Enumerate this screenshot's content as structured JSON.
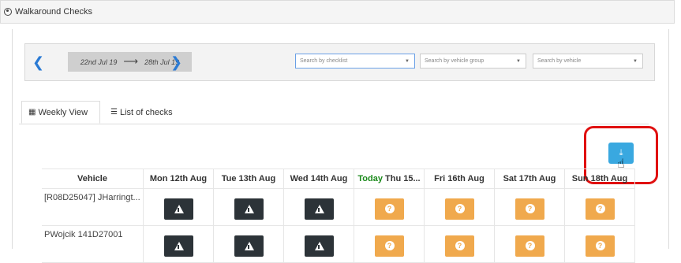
{
  "header": {
    "title": "Walkaround Checks",
    "icon": "user-circle-icon"
  },
  "date_nav": {
    "start": "22nd Jul 19",
    "end": "28th Jul 19",
    "arrow": "⟶"
  },
  "filters": {
    "checklist_placeholder": "Search by checklist",
    "vehicle_group_placeholder": "Search by vehicle group",
    "vehicle_placeholder": "Search by vehicle"
  },
  "tabs": {
    "weekly": "Weekly View",
    "list": "List of checks"
  },
  "table": {
    "headers": [
      "Vehicle",
      "Mon 12th Aug",
      "Tue 13th Aug",
      "Wed 14th Aug",
      "Today",
      "Thu 15...",
      "Fri 16th Aug",
      "Sat 17th Aug",
      "Sun 18th Aug"
    ],
    "rows": [
      {
        "vehicle": "[R08D25047] JHarringt...",
        "statuses": [
          "warning",
          "warning",
          "warning",
          "unknown",
          "unknown",
          "unknown",
          "unknown"
        ]
      },
      {
        "vehicle": "PWojcik 141D27001",
        "statuses": [
          "warning",
          "warning",
          "warning",
          "unknown",
          "unknown",
          "unknown",
          "unknown"
        ]
      }
    ]
  },
  "colors": {
    "warning": "#2c3338",
    "unknown": "#f0a94d",
    "download": "#39a8e0",
    "highlight": "#e01010",
    "today": "#1b8a1b"
  }
}
